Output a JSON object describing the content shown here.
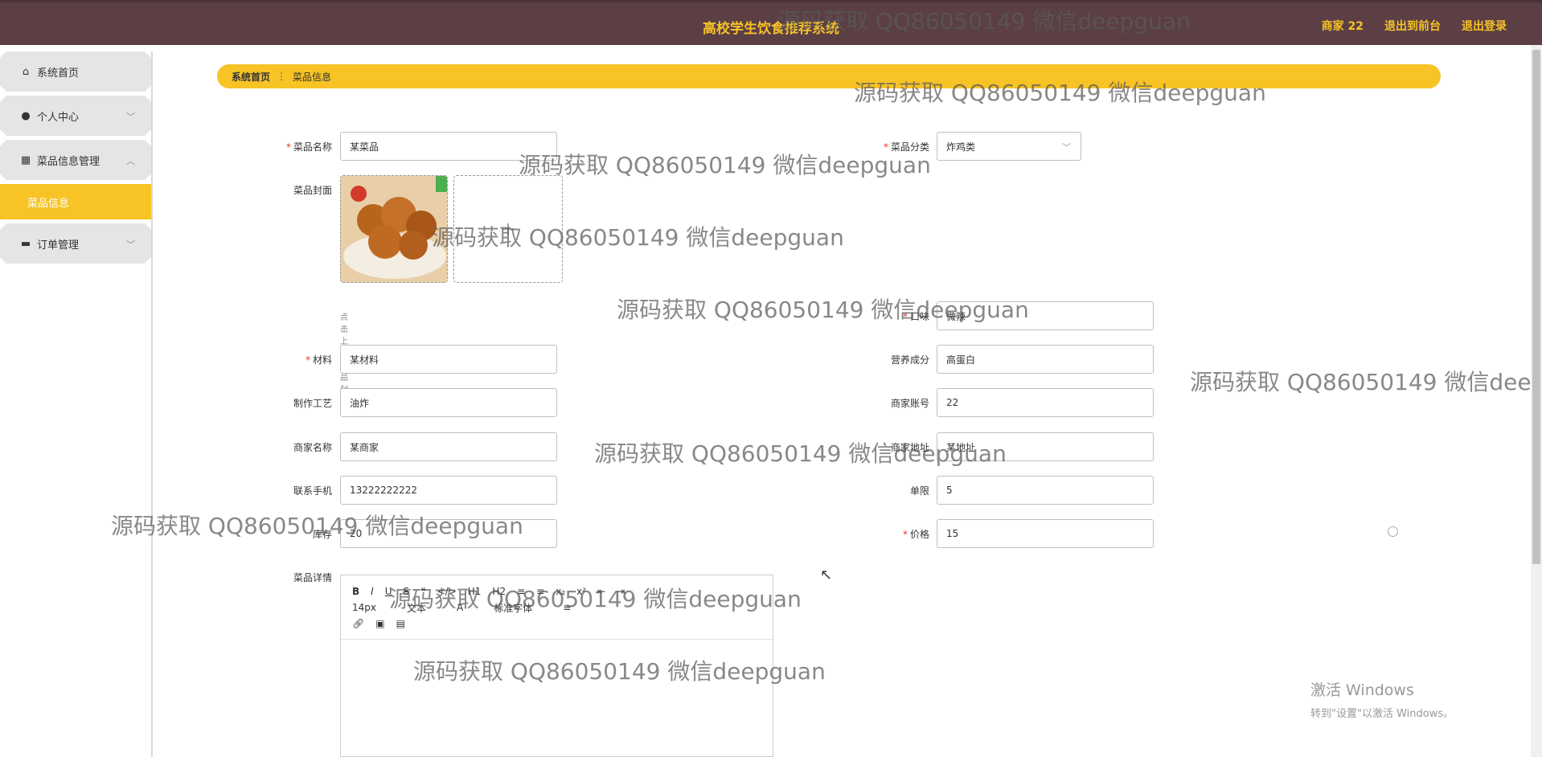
{
  "header": {
    "title": "高校学生饮食推荐系统",
    "links": [
      "商家 22",
      "退出到前台",
      "退出登录"
    ]
  },
  "sidebar": {
    "items": [
      {
        "label": "系统首页",
        "icon": "home-icon"
      },
      {
        "label": "个人中心",
        "icon": "user-icon"
      },
      {
        "label": "菜品信息管理",
        "icon": "grid-icon"
      },
      {
        "label": "菜品信息"
      },
      {
        "label": "订单管理",
        "icon": "monitor-icon"
      }
    ]
  },
  "breadcrumb": {
    "home": "系统首页",
    "current": "菜品信息"
  },
  "form": {
    "name_label": "菜品名称",
    "name_value": "某菜品",
    "category_label": "菜品分类",
    "category_value": "炸鸡类",
    "cover_label": "菜品封面",
    "cover_hint": "点击上传菜品封面",
    "taste_label": "口味",
    "taste_value": "微辣",
    "material_label": "材料",
    "material_value": "某材料",
    "nutrition_label": "营养成分",
    "nutrition_value": "高蛋白",
    "process_label": "制作工艺",
    "process_value": "油炸",
    "merchant_account_label": "商家账号",
    "merchant_account_value": "22",
    "merchant_name_label": "商家名称",
    "merchant_name_value": "某商家",
    "merchant_address_label": "商家地址",
    "merchant_address_value": "某地址",
    "phone_label": "联系手机",
    "phone_value": "13222222222",
    "limit_label": "单限",
    "limit_value": "5",
    "stock_label": "库存",
    "stock_value": "20",
    "price_label": "价格",
    "price_value": "15",
    "detail_label": "菜品详情"
  },
  "editor": {
    "row1": [
      "B",
      "I",
      "U",
      "S",
      "❝",
      "</>",
      "H1",
      "H2",
      "≡",
      "≡",
      "x₂",
      "x²",
      "⇤",
      "⇥"
    ],
    "font_size": "14px",
    "format": "文本",
    "font_family": "标准字体"
  },
  "watermark": "源码获取 QQ86050149 微信deepguan",
  "os": {
    "activate_title": "激活 Windows",
    "activate_sub": "转到\"设置\"以激活 Windows。"
  }
}
